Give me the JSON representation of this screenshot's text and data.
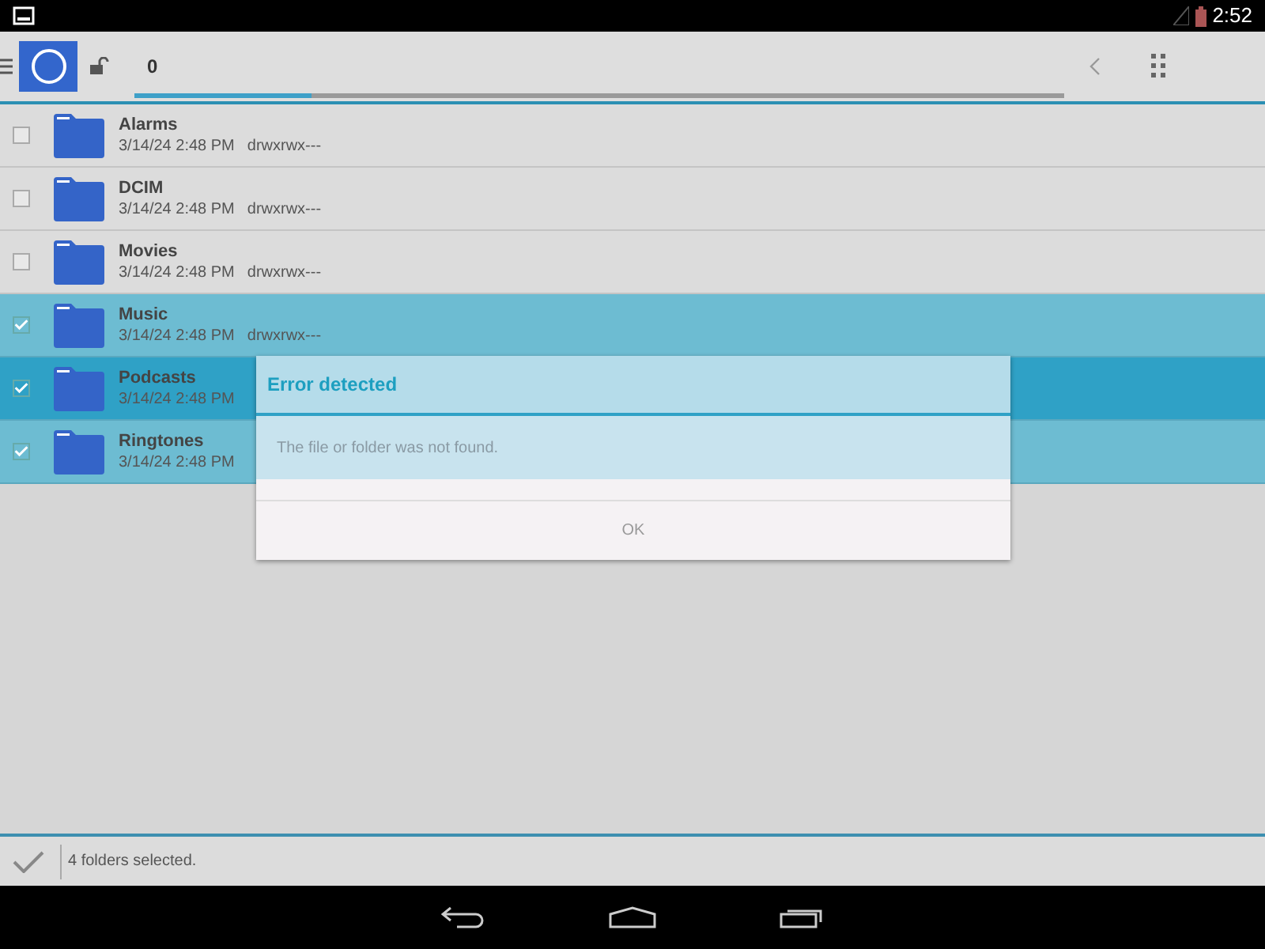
{
  "status_bar": {
    "time": "2:52"
  },
  "toolbar": {
    "path_text": "0",
    "progress": {
      "level": 0.19
    }
  },
  "files": [
    {
      "name": "Alarms",
      "date": "3/14/24 2:48 PM",
      "permissions": "drwxrwx---",
      "checked": false,
      "focused": false
    },
    {
      "name": "DCIM",
      "date": "3/14/24 2:48 PM",
      "permissions": "drwxrwx---",
      "checked": false,
      "focused": false
    },
    {
      "name": "Movies",
      "date": "3/14/24 2:48 PM",
      "permissions": "drwxrwx---",
      "checked": false,
      "focused": false
    },
    {
      "name": "Music",
      "date": "3/14/24 2:48 PM",
      "permissions": "drwxrwx---",
      "checked": true,
      "focused": false
    },
    {
      "name": "Podcasts",
      "date": "3/14/24 2:48 PM",
      "checked": true,
      "focused": true
    },
    {
      "name": "Ringtones",
      "date": "3/14/24 2:48 PM",
      "checked": true,
      "focused": false
    }
  ],
  "dialog": {
    "title": "Error detected",
    "message": "The file or folder was not found.",
    "button": "OK"
  },
  "selection_bar": {
    "text": "4 folders selected."
  }
}
